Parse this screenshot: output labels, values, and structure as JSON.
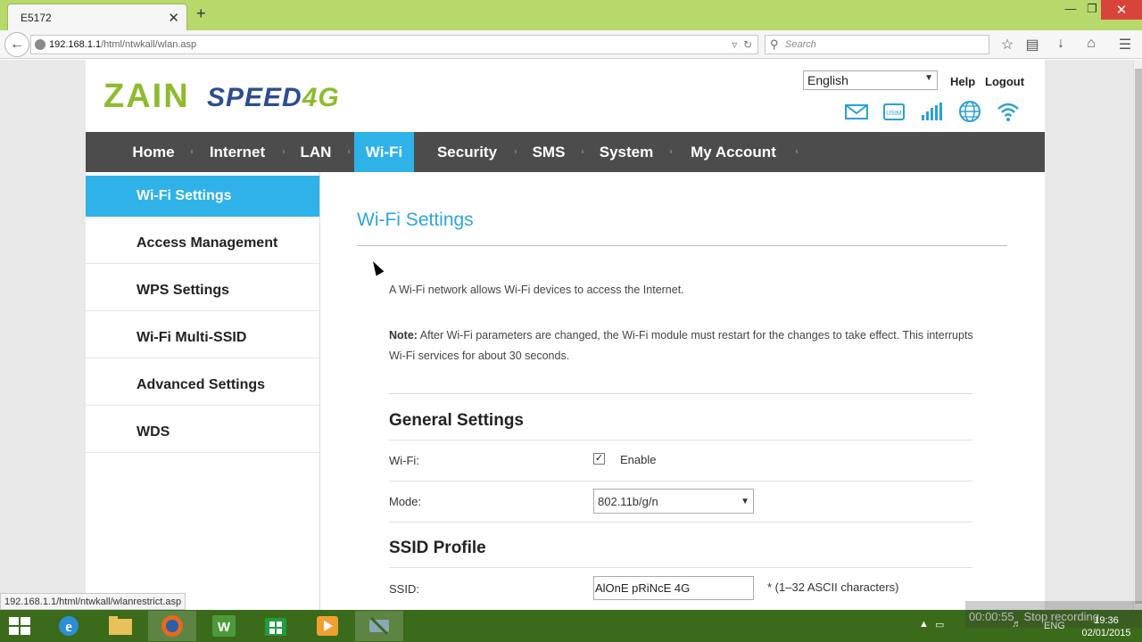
{
  "browser": {
    "tab_title": "E5172",
    "tab_close": "✕",
    "new_tab": "+",
    "url_host": "192.168.1.1",
    "url_path": "/html/ntwkall/wlan.asp",
    "search_placeholder": "Search",
    "status_url": "192.168.1.1/html/ntwkall/wlanrestrict.asp"
  },
  "header": {
    "logo_zain": "ZAIN",
    "logo_speed": "SPEED",
    "logo_4g": "4G",
    "language": "English",
    "help": "Help",
    "logout": "Logout"
  },
  "nav": {
    "items": [
      "Home",
      "Internet",
      "LAN",
      "Wi-Fi",
      "Security",
      "SMS",
      "System",
      "My Account"
    ],
    "active": "Wi-Fi"
  },
  "sidebar": {
    "items": [
      "Wi-Fi Settings",
      "Access Management",
      "WPS Settings",
      "Wi-Fi Multi-SSID",
      "Advanced Settings",
      "WDS"
    ],
    "active": "Wi-Fi Settings"
  },
  "content": {
    "title": "Wi-Fi Settings",
    "description": "A Wi-Fi network allows Wi-Fi devices to access the Internet.",
    "note_label": "Note:",
    "note_text": " After Wi-Fi parameters are changed, the Wi-Fi module must restart for the changes to take effect. This interrupts Wi-Fi services for about 30 seconds.",
    "general_heading": "General Settings",
    "wifi_label": "Wi-Fi:",
    "wifi_enable_label": "Enable",
    "wifi_enabled": true,
    "mode_label": "Mode:",
    "mode_value": "802.11b/g/n",
    "ssid_heading": "SSID Profile",
    "ssid_label": "SSID:",
    "ssid_value": "AlOnE pRiNcE 4G",
    "ssid_hint": "*   (1–32 ASCII characters)"
  },
  "taskbar": {
    "recording_time": "00:00:55",
    "recording_label": "Stop recording",
    "language": "ENG",
    "time": "19:36",
    "date": "02/01/2015"
  },
  "colors": {
    "accent": "#2fb2e8",
    "nav_bg": "#4c4c4c",
    "zain_green": "#8dbb2e",
    "speed_blue": "#2b4e8f"
  }
}
